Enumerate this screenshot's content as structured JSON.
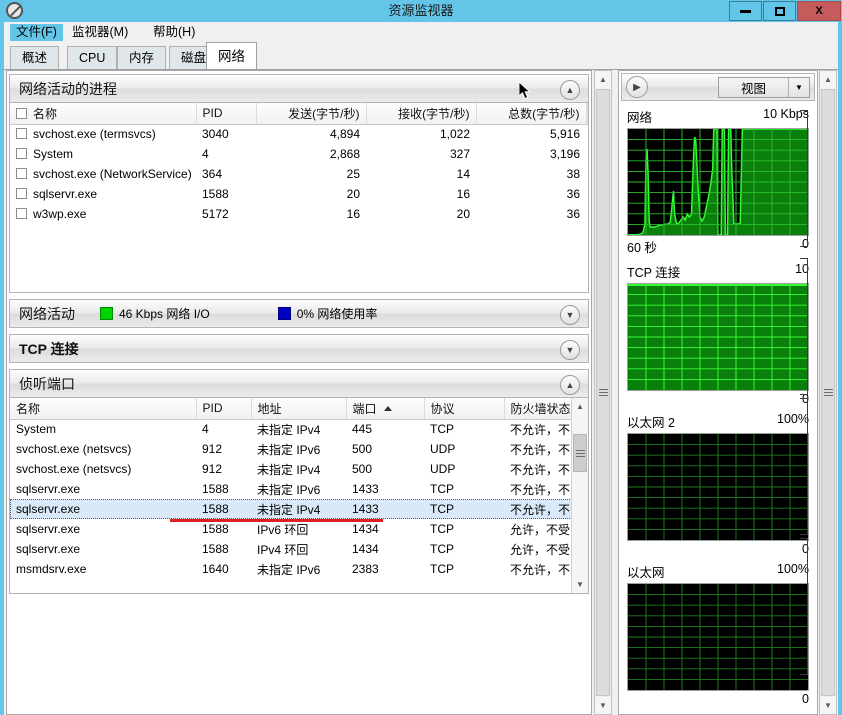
{
  "window": {
    "title": "资源监视器",
    "icon": "resource-monitor-icon",
    "minimize_label": "最小化",
    "maximize_label": "最大化",
    "close_label": "X"
  },
  "menu": {
    "items": [
      {
        "label": "文件(F)",
        "name": "menu-file",
        "selected": true
      },
      {
        "label": "监视器(M)",
        "name": "menu-monitor",
        "selected": false
      },
      {
        "label": "帮助(H)",
        "name": "menu-help",
        "selected": false
      }
    ]
  },
  "tabs": [
    {
      "label": "概述",
      "name": "tab-overview",
      "active": false
    },
    {
      "label": "CPU",
      "name": "tab-cpu",
      "active": false
    },
    {
      "label": "内存",
      "name": "tab-memory",
      "active": false
    },
    {
      "label": "磁盘",
      "name": "tab-disk",
      "active": false
    },
    {
      "label": "网络",
      "name": "tab-network",
      "active": true
    }
  ],
  "processes_section": {
    "title": "网络活动的进程",
    "collapse_icon": "chevron-up-icon",
    "columns": [
      "名称",
      "PID",
      "发送(字节/秒)",
      "接收(字节/秒)",
      "总数(字节/秒)"
    ],
    "rows": [
      {
        "name": "svchost.exe (termsvcs)",
        "pid": "3040",
        "sent": "4,894",
        "received": "1,022",
        "total": "5,916",
        "checked": false
      },
      {
        "name": "System",
        "pid": "4",
        "sent": "2,868",
        "received": "327",
        "total": "3,196",
        "checked": false
      },
      {
        "name": "svchost.exe (NetworkService)",
        "pid": "364",
        "sent": "25",
        "received": "14",
        "total": "38",
        "checked": false
      },
      {
        "name": "sqlservr.exe",
        "pid": "1588",
        "sent": "20",
        "received": "16",
        "total": "36",
        "checked": false
      },
      {
        "name": "w3wp.exe",
        "pid": "5172",
        "sent": "16",
        "received": "20",
        "total": "36",
        "checked": false
      }
    ]
  },
  "network_activity_section": {
    "title": "网络活动",
    "io_value": "46 Kbps 网络 I/O",
    "io_color": "#00d400",
    "usage_value": "0% 网络使用率",
    "usage_color": "#0000c0",
    "collapse_icon": "chevron-down-icon"
  },
  "tcp_section": {
    "title": "TCP 连接",
    "collapse_icon": "chevron-down-icon"
  },
  "ports_section": {
    "title": "侦听端口",
    "collapse_icon": "chevron-up-icon",
    "columns": [
      "名称",
      "PID",
      "地址",
      "端口",
      "协议",
      "防火墙状态"
    ],
    "sorted_column": "端口",
    "sort_direction": "asc",
    "rows": [
      {
        "name": "System",
        "pid": "4",
        "address": "未指定 IPv4",
        "port": "445",
        "protocol": "TCP",
        "firewall": "不允许，不...",
        "selected": false
      },
      {
        "name": "svchost.exe (netsvcs)",
        "pid": "912",
        "address": "未指定 IPv6",
        "port": "500",
        "protocol": "UDP",
        "firewall": "不允许，不...",
        "selected": false
      },
      {
        "name": "svchost.exe (netsvcs)",
        "pid": "912",
        "address": "未指定 IPv4",
        "port": "500",
        "protocol": "UDP",
        "firewall": "不允许，不...",
        "selected": false
      },
      {
        "name": "sqlservr.exe",
        "pid": "1588",
        "address": "未指定 IPv6",
        "port": "1433",
        "protocol": "TCP",
        "firewall": "不允许，不...",
        "selected": false
      },
      {
        "name": "sqlservr.exe",
        "pid": "1588",
        "address": "未指定 IPv4",
        "port": "1433",
        "protocol": "TCP",
        "firewall": "不允许，不...",
        "selected": true
      },
      {
        "name": "sqlservr.exe",
        "pid": "1588",
        "address": "IPv6 环回",
        "port": "1434",
        "protocol": "TCP",
        "firewall": "允许，不受...",
        "selected": false
      },
      {
        "name": "sqlservr.exe",
        "pid": "1588",
        "address": "IPv4 环回",
        "port": "1434",
        "protocol": "TCP",
        "firewall": "允许，不受...",
        "selected": false
      },
      {
        "name": "msmdsrv.exe",
        "pid": "1640",
        "address": "未指定 IPv6",
        "port": "2383",
        "protocol": "TCP",
        "firewall": "不允许，不...",
        "selected": false
      }
    ]
  },
  "right_panel": {
    "expand_icon": "chevron-right-icon",
    "view_button": {
      "label": "视图",
      "dropdown_icon": "chevron-down-icon"
    },
    "graphs": [
      {
        "title": "网络",
        "max": "10 Kbps",
        "min": "0",
        "footer_left": "60 秒",
        "style": "line",
        "background": "#000000",
        "line_color": "#33ff33"
      },
      {
        "title": "TCP 连接",
        "max": "10",
        "min": "0",
        "footer_left": "",
        "style": "filled",
        "background": "#0b7f0b",
        "line_color": "#33ff33"
      },
      {
        "title": "以太网 2",
        "max": "100%",
        "min": "0",
        "footer_left": "",
        "style": "empty",
        "background": "#000000",
        "line_color": "#33ff33"
      },
      {
        "title": "以太网",
        "max": "100%",
        "min": "0",
        "footer_left": "",
        "style": "empty",
        "background": "#000000",
        "line_color": "#33ff33"
      }
    ]
  },
  "chart_data": {
    "type": "line",
    "title": "网络",
    "ylabel": "Kbps",
    "xlabel": "60 秒",
    "ylim": [
      0,
      10
    ],
    "x": [
      0,
      1,
      2,
      3,
      4,
      5,
      6,
      7,
      8,
      9,
      10,
      11,
      12,
      13,
      14,
      15,
      16,
      17,
      18,
      19,
      20,
      21,
      22,
      23,
      24,
      25,
      26,
      27,
      28,
      29,
      30,
      31,
      32,
      33,
      34,
      35,
      36,
      37,
      38,
      39,
      40,
      41,
      42,
      43,
      44,
      45,
      46,
      47,
      48,
      49,
      50,
      51,
      52,
      53,
      54,
      55,
      56,
      57,
      58,
      59,
      60
    ],
    "values": [
      0.3,
      0.3,
      0.3,
      0.3,
      0.3,
      0.4,
      0.4,
      0.4,
      0.5,
      1.0,
      7.8,
      8.2,
      3.0,
      1.0,
      0.6,
      0.5,
      0.5,
      0.5,
      0.5,
      0.5,
      0.5,
      0.5,
      0.6,
      1.2,
      3.3,
      1.4,
      0.7,
      0.8,
      1.4,
      1.2,
      1.0,
      1.2,
      9.0,
      9.4,
      4.5,
      1.2,
      0.9,
      1.6,
      2.6,
      3.6,
      4.6,
      6.0,
      10.0,
      10.0,
      0.3,
      0.3,
      10.0,
      10.0,
      0.4,
      10.0,
      10.0,
      6.5,
      0.6,
      0.6,
      0.6,
      10.0,
      10.0,
      10.0,
      10.0,
      10.0,
      10.0
    ],
    "grid": true,
    "legend": "none"
  },
  "scrollbars": {
    "left_pane": {
      "up_icon": "chevron-up-icon",
      "down_icon": "chevron-down-icon"
    },
    "right_pane": {
      "up_icon": "chevron-up-icon",
      "down_icon": "chevron-down-icon"
    },
    "ports_list": {
      "up_icon": "chevron-up-icon",
      "down_icon": "chevron-down-icon"
    }
  }
}
